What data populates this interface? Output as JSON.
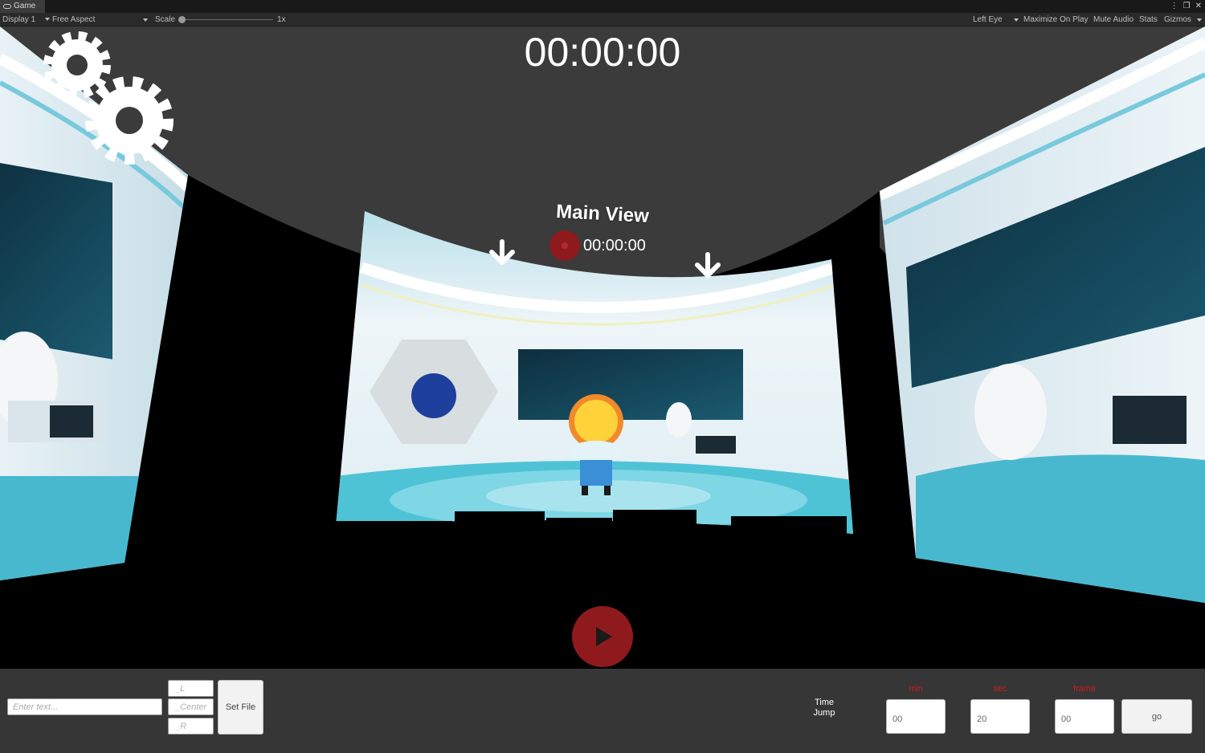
{
  "editor": {
    "tab_title": "Game",
    "display_label": "Display 1",
    "aspect_label": "Free Aspect",
    "scale_label": "Scale",
    "scale_value": "1x",
    "eye_label": "Left Eye",
    "toggles": [
      "Maximize On Play",
      "Mute Audio",
      "Stats",
      "Gizmos"
    ]
  },
  "viewport": {
    "main_timer": "00:00:00",
    "main_view_title": "Main View",
    "main_view_timer": "00:00:00"
  },
  "controls": {
    "text_placeholder": "Enter text...",
    "field_l_placeholder": "_L",
    "field_center_placeholder": "_Center",
    "field_r_placeholder": "_R",
    "set_file_label": "Set File",
    "time_jump_label": "Time Jump",
    "min_caption": "min",
    "sec_caption": "sec",
    "frame_caption": "frame",
    "min_value": "00",
    "sec_value": "20",
    "frame_value": "00",
    "go_label": "go"
  },
  "colors": {
    "record_red": "#8e1a1e",
    "caption_red": "#d11c1c",
    "scene_teal": "#4fc3d6"
  }
}
